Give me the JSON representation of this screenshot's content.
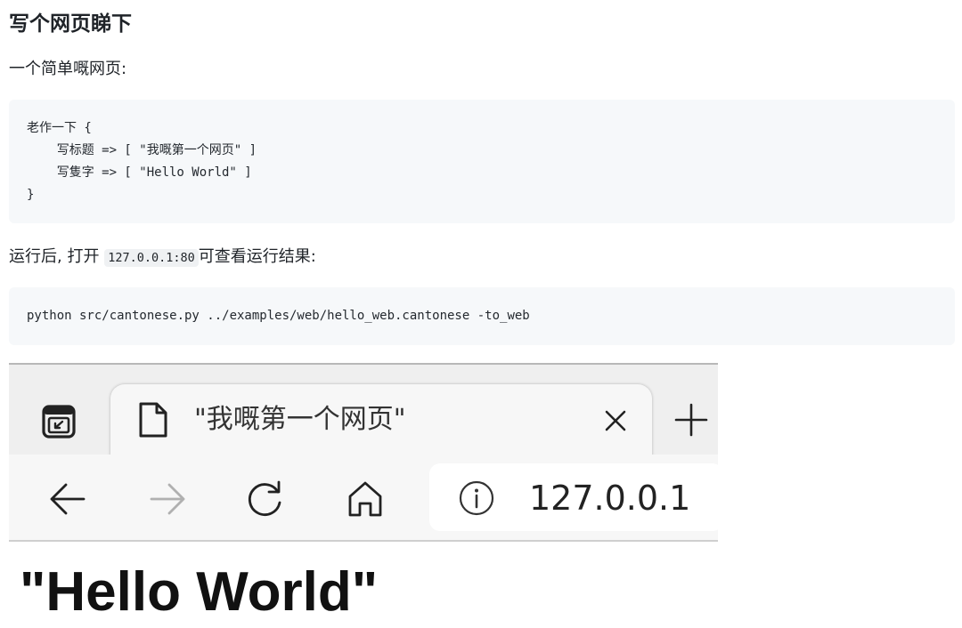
{
  "doc": {
    "heading": "写个网页睇下",
    "intro": "一个简单嘅网页:",
    "code_lines": [
      "老作一下 {",
      "    写标题 => [ \"我嘅第一个网页\" ]",
      "    写隻字 => [ \"Hello World\" ]",
      "}"
    ],
    "run_prefix": "运行后, 打开",
    "run_code": "127.0.0.1:80",
    "run_suffix": "可查看运行结果:",
    "command": "python src/cantonese.py ../examples/web/hello_web.cantonese -to_web"
  },
  "browser": {
    "tab_title": "\"我嘅第一个网页\"",
    "url": "127.0.0.1",
    "page_text": "\"Hello World\"",
    "icons": {
      "workspaces": "workspaces-icon",
      "page": "page-icon",
      "close": "close-icon",
      "new_tab": "plus-icon",
      "back": "back-arrow-icon",
      "forward": "forward-arrow-icon",
      "refresh": "refresh-icon",
      "home": "home-icon",
      "info": "info-icon"
    }
  }
}
